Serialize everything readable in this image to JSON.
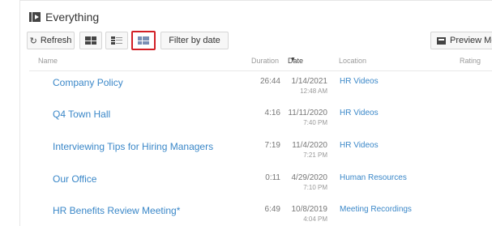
{
  "app": {
    "title": "Everything"
  },
  "toolbar": {
    "refresh_label": "Refresh",
    "refresh_icon": "↻",
    "filter_label": "Filter by date",
    "preview_label": "Preview Mod",
    "active_view": "list-view",
    "highlight_color": "#d21f26"
  },
  "columns": {
    "name": "Name",
    "duration": "Duration",
    "date": "Date",
    "date_sort_icon": "▼",
    "location": "Location",
    "rating": "Rating"
  },
  "rows": [
    {
      "name": "Company Policy",
      "duration": "26:44",
      "date": "1/14/2021",
      "time": "12:48 AM",
      "location": "HR Videos"
    },
    {
      "name": "Q4 Town Hall",
      "duration": "4:16",
      "date": "11/11/2020",
      "time": "7:40 PM",
      "location": "HR Videos"
    },
    {
      "name": "Interviewing Tips for Hiring Managers",
      "duration": "7:19",
      "date": "11/4/2020",
      "time": "7:21 PM",
      "location": "HR Videos"
    },
    {
      "name": "Our Office",
      "duration": "0:11",
      "date": "4/29/2020",
      "time": "7:10 PM",
      "location": "Human Resources"
    },
    {
      "name": "HR Benefits Review Meeting*",
      "duration": "6:49",
      "date": "10/8/2019",
      "time": "4:04 PM",
      "location": "Meeting Recordings"
    }
  ],
  "colors": {
    "link": "#3a87c8",
    "muted": "#9a9a9a"
  }
}
